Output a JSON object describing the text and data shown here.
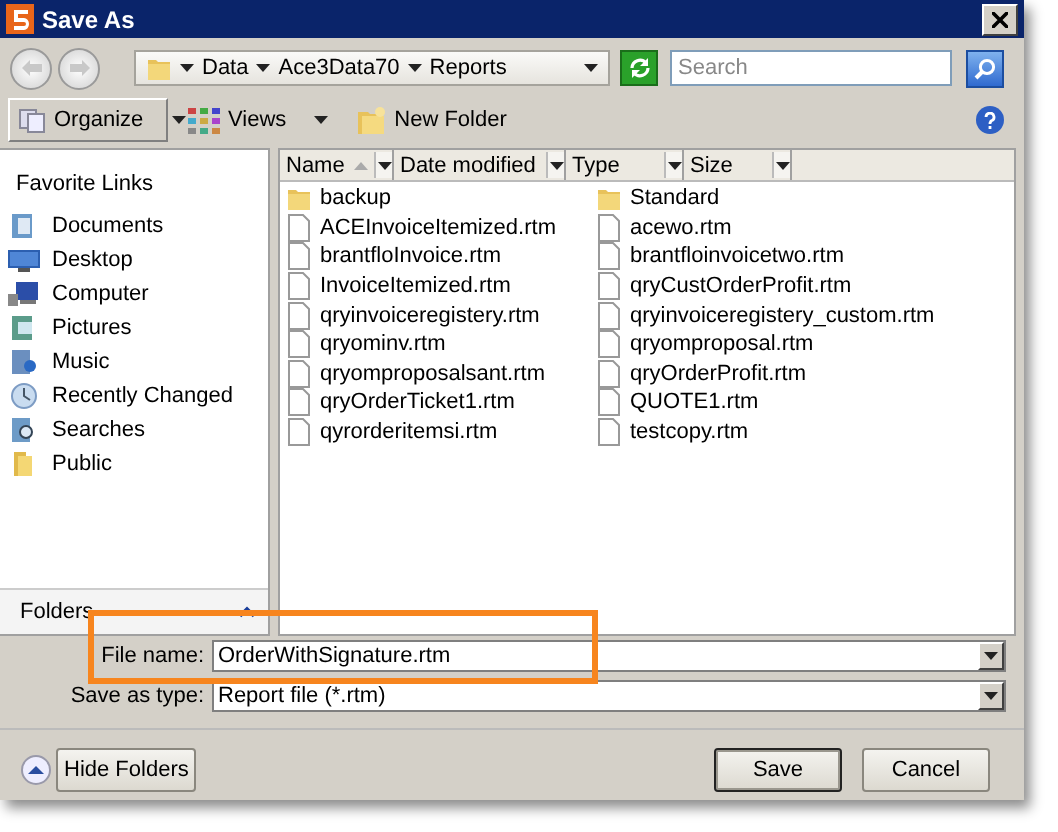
{
  "window": {
    "title": "Save As"
  },
  "address": {
    "path": [
      "Data",
      "Ace3Data70",
      "Reports"
    ]
  },
  "search": {
    "placeholder": "Search"
  },
  "toolbar": [
    {
      "label": "Organize",
      "kind": "menu"
    },
    {
      "label": "Views",
      "kind": "menu"
    },
    {
      "label": "New Folder",
      "kind": "button"
    }
  ],
  "sidebar": {
    "title": "Favorite Links",
    "items": [
      {
        "label": "Documents"
      },
      {
        "label": "Desktop"
      },
      {
        "label": "Computer"
      },
      {
        "label": "Pictures"
      },
      {
        "label": "Music"
      },
      {
        "label": "Recently Changed"
      },
      {
        "label": "Searches"
      },
      {
        "label": "Public"
      }
    ],
    "folders_label": "Folders"
  },
  "columns": [
    {
      "label": "Name",
      "sorted": true
    },
    {
      "label": "Date modified",
      "sorted": false
    },
    {
      "label": "Type",
      "sorted": false
    },
    {
      "label": "Size",
      "sorted": false
    }
  ],
  "files": [
    {
      "name": "backup",
      "kind": "folder"
    },
    {
      "name": "ACEInvoiceItemized.rtm",
      "kind": "file"
    },
    {
      "name": "brantfloInvoice.rtm",
      "kind": "file"
    },
    {
      "name": "InvoiceItemized.rtm",
      "kind": "file"
    },
    {
      "name": "qryinvoiceregistery.rtm",
      "kind": "file"
    },
    {
      "name": "qryominv.rtm",
      "kind": "file"
    },
    {
      "name": "qryomproposalsant.rtm",
      "kind": "file"
    },
    {
      "name": "qryOrderTicket1.rtm",
      "kind": "file"
    },
    {
      "name": "qyrorderitemsi.rtm",
      "kind": "file"
    },
    {
      "name": "Standard",
      "kind": "folder"
    },
    {
      "name": "acewo.rtm",
      "kind": "file"
    },
    {
      "name": "brantfloinvoicetwo.rtm",
      "kind": "file"
    },
    {
      "name": "qryCustOrderProfit.rtm",
      "kind": "file"
    },
    {
      "name": "qryinvoiceregistery_custom.rtm",
      "kind": "file"
    },
    {
      "name": "qryomproposal.rtm",
      "kind": "file"
    },
    {
      "name": "qryOrderProfit.rtm",
      "kind": "file"
    },
    {
      "name": "QUOTE1.rtm",
      "kind": "file"
    },
    {
      "name": "testcopy.rtm",
      "kind": "file"
    }
  ],
  "file_name": {
    "label": "File name:",
    "value": "OrderWithSignature.rtm"
  },
  "save_type": {
    "label": "Save as type:",
    "value": "Report file (*.rtm)"
  },
  "hide_folders": "Hide Folders",
  "buttons": [
    {
      "label": "Save",
      "default": true
    },
    {
      "label": "Cancel",
      "default": false
    }
  ],
  "annotation": {
    "kind": "box"
  }
}
